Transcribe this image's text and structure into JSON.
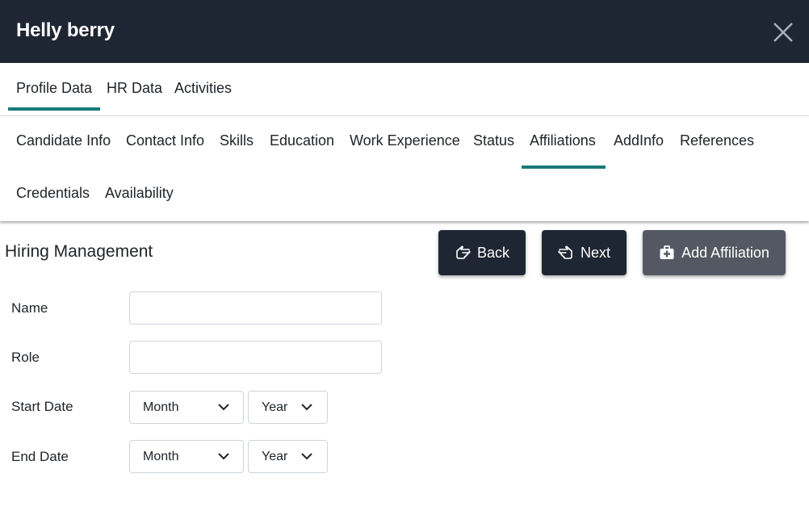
{
  "header": {
    "title": "Helly berry",
    "close_icon": "close-icon"
  },
  "primary_tabs": [
    {
      "label": "Profile Data",
      "active": true
    },
    {
      "label": "HR Data"
    },
    {
      "label": "Activities"
    }
  ],
  "secondary_tabs": [
    {
      "label": "Candidate Info"
    },
    {
      "label": "Contact Info"
    },
    {
      "label": "Skills"
    },
    {
      "label": "Education"
    },
    {
      "label": "Work Experience"
    },
    {
      "label": "Status"
    },
    {
      "label": "Affiliations",
      "active": true
    },
    {
      "label": "AddInfo"
    },
    {
      "label": "References"
    },
    {
      "label": "Credentials"
    },
    {
      "label": "Availability"
    }
  ],
  "section": {
    "title": "Hiring Management"
  },
  "actions": {
    "back_label": "Back",
    "next_label": "Next",
    "add_label": "Add Affiliation"
  },
  "form": {
    "name_label": "Name",
    "name_value": "",
    "role_label": "Role",
    "role_value": "",
    "start_label": "Start Date",
    "start_month": "Month",
    "start_year": "Year",
    "end_label": "End Date",
    "end_month": "Month",
    "end_year": "Year"
  },
  "colors": {
    "header_bg": "#1f2633",
    "accent": "#197a7a",
    "add_button": "#535862"
  }
}
